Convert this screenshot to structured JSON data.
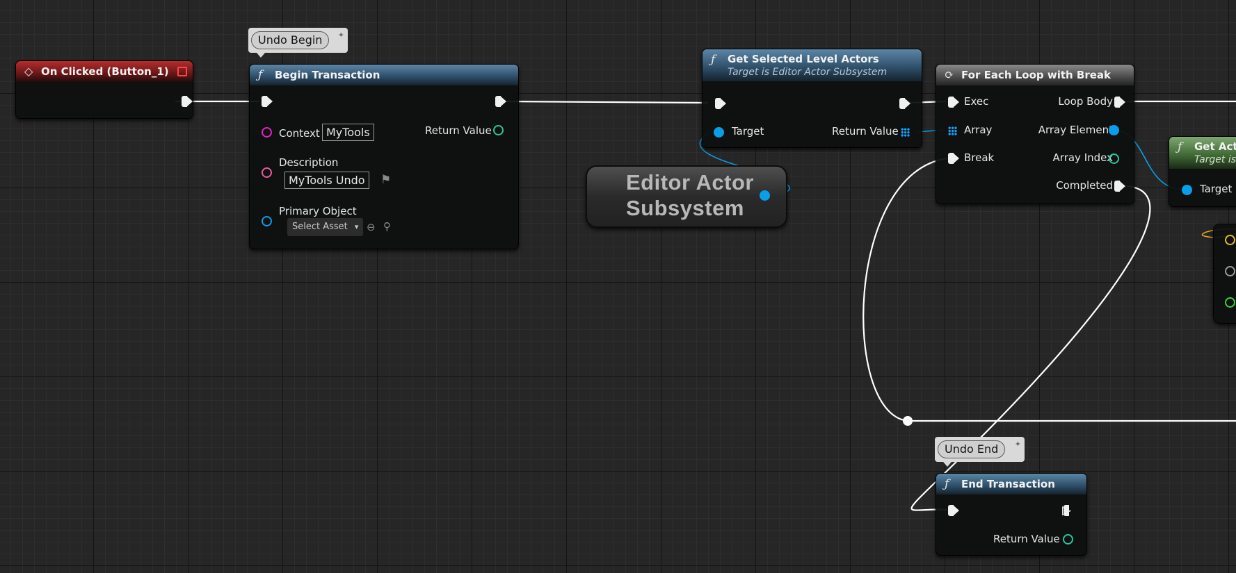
{
  "nodes": {
    "on_clicked": {
      "title": "On Clicked (Button_1)"
    },
    "begin_transaction": {
      "title": "Begin Transaction",
      "context_label": "Context",
      "context_value": "MyTools",
      "description_label": "Description",
      "description_value": "MyTools Undo",
      "primary_object_label": "Primary Object",
      "select_asset": "Select Asset",
      "return_value": "Return Value"
    },
    "get_selected": {
      "title": "Get Selected Level Actors",
      "subtitle": "Target is Editor Actor Subsystem",
      "target_label": "Target",
      "return_value": "Return Value"
    },
    "editor_actor_subsystem": {
      "line1": "Editor Actor",
      "line2": "Subsystem"
    },
    "for_each": {
      "title": "For Each Loop with Break",
      "exec": "Exec",
      "array": "Array",
      "break": "Break",
      "loop_body": "Loop Body",
      "array_element": "Array Element",
      "array_index": "Array Index",
      "completed": "Completed"
    },
    "get_actor": {
      "title": "Get Act",
      "subtitle": "Target is",
      "target_label": "Target"
    },
    "end_transaction": {
      "title": "End Transaction",
      "return_value": "Return Value"
    }
  },
  "comments": {
    "undo_begin": "Undo Begin",
    "undo_end": "Undo End"
  },
  "colors": {
    "exec_wire": "#ffffff",
    "object_wire": "#0a9eea",
    "string_pin": "#ea1fc2",
    "text_pin": "#e65c9d",
    "int_pin": "#27c79a",
    "event_header": "#b62d2d",
    "function_header": "#3e6684",
    "pure_header": "#5f8b4f"
  },
  "icons": {
    "event": "event-diamond-icon",
    "function": "function-icon",
    "loop": "loop-macro-icon",
    "pin": "comment-pin-icon"
  }
}
